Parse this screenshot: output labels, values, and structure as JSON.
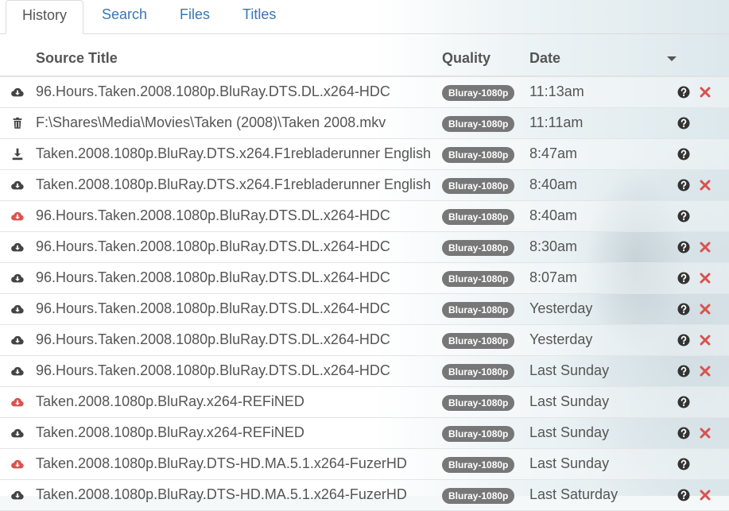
{
  "colors": {
    "link": "#3a76b4",
    "text": "#555555",
    "badge": "#777777",
    "failed": "#d9534f",
    "delete": "#d9534f"
  },
  "tabs": [
    {
      "label": "History",
      "active": true
    },
    {
      "label": "Search"
    },
    {
      "label": "Files"
    },
    {
      "label": "Titles"
    }
  ],
  "table": {
    "headers": {
      "source": "Source Title",
      "quality": "Quality",
      "date": "Date"
    },
    "rows": [
      {
        "icon": "cloud-download-icon",
        "failed": false,
        "title": "96.Hours.Taken.2008.1080p.BluRay.DTS.DL.x264-HDC",
        "quality": "Bluray-1080p",
        "date": "11:13am",
        "deletable": true
      },
      {
        "icon": "trash-icon",
        "failed": false,
        "title": "F:\\Shares\\Media\\Movies\\Taken (2008)\\Taken 2008.mkv",
        "quality": "Bluray-1080p",
        "date": "11:11am",
        "deletable": false
      },
      {
        "icon": "import-icon",
        "failed": false,
        "title": "Taken.2008.1080p.BluRay.DTS.x264.F1rebladerunner English",
        "quality": "Bluray-1080p",
        "date": "8:47am",
        "deletable": false
      },
      {
        "icon": "cloud-download-icon",
        "failed": false,
        "title": "Taken.2008.1080p.BluRay.DTS.x264.F1rebladerunner English",
        "quality": "Bluray-1080p",
        "date": "8:40am",
        "deletable": true
      },
      {
        "icon": "cloud-download-icon",
        "failed": true,
        "title": "96.Hours.Taken.2008.1080p.BluRay.DTS.DL.x264-HDC",
        "quality": "Bluray-1080p",
        "date": "8:40am",
        "deletable": false
      },
      {
        "icon": "cloud-download-icon",
        "failed": false,
        "title": "96.Hours.Taken.2008.1080p.BluRay.DTS.DL.x264-HDC",
        "quality": "Bluray-1080p",
        "date": "8:30am",
        "deletable": true
      },
      {
        "icon": "cloud-download-icon",
        "failed": false,
        "title": "96.Hours.Taken.2008.1080p.BluRay.DTS.DL.x264-HDC",
        "quality": "Bluray-1080p",
        "date": "8:07am",
        "deletable": true
      },
      {
        "icon": "cloud-download-icon",
        "failed": false,
        "title": "96.Hours.Taken.2008.1080p.BluRay.DTS.DL.x264-HDC",
        "quality": "Bluray-1080p",
        "date": "Yesterday",
        "deletable": true
      },
      {
        "icon": "cloud-download-icon",
        "failed": false,
        "title": "96.Hours.Taken.2008.1080p.BluRay.DTS.DL.x264-HDC",
        "quality": "Bluray-1080p",
        "date": "Yesterday",
        "deletable": true
      },
      {
        "icon": "cloud-download-icon",
        "failed": false,
        "title": "96.Hours.Taken.2008.1080p.BluRay.DTS.DL.x264-HDC",
        "quality": "Bluray-1080p",
        "date": "Last Sunday",
        "deletable": true
      },
      {
        "icon": "cloud-download-icon",
        "failed": true,
        "title": "Taken.2008.1080p.BluRay.x264-REFiNED",
        "quality": "Bluray-1080p",
        "date": "Last Sunday",
        "deletable": false
      },
      {
        "icon": "cloud-download-icon",
        "failed": false,
        "title": "Taken.2008.1080p.BluRay.x264-REFiNED",
        "quality": "Bluray-1080p",
        "date": "Last Sunday",
        "deletable": true
      },
      {
        "icon": "cloud-download-icon",
        "failed": true,
        "title": "Taken.2008.1080p.BluRay.DTS-HD.MA.5.1.x264-FuzerHD",
        "quality": "Bluray-1080p",
        "date": "Last Sunday",
        "deletable": false
      },
      {
        "icon": "cloud-download-icon",
        "failed": false,
        "title": "Taken.2008.1080p.BluRay.DTS-HD.MA.5.1.x264-FuzerHD",
        "quality": "Bluray-1080p",
        "date": "Last Saturday",
        "deletable": true
      }
    ]
  }
}
